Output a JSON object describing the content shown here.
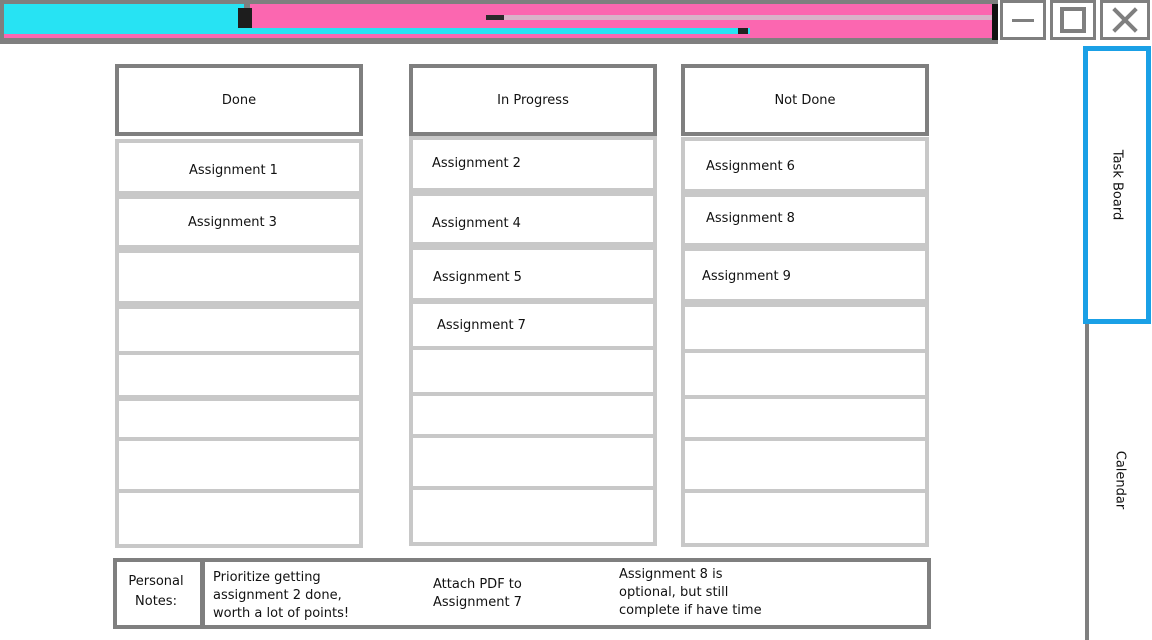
{
  "window": {
    "minimize_label": "",
    "maximize_label": "",
    "close_label": ""
  },
  "columns": {
    "done": {
      "title": "Done",
      "items": [
        "Assignment 1",
        "Assignment 3",
        "",
        "",
        "",
        "",
        "",
        ""
      ]
    },
    "in_progress": {
      "title": "In Progress",
      "items": [
        "Assignment 2",
        "Assignment 4",
        "Assignment 5",
        "Assignment 7",
        "",
        "",
        "",
        ""
      ]
    },
    "not_done": {
      "title": "Not Done",
      "items": [
        "Assignment 6",
        "Assignment 8",
        "Assignment 9",
        "",
        "",
        "",
        "",
        ""
      ]
    }
  },
  "sidebar": {
    "tabs": [
      {
        "label": "Task Board",
        "active": true
      },
      {
        "label": "Calendar",
        "active": false
      }
    ]
  },
  "notes": {
    "label_line1": "Personal",
    "label_line2": "Notes:",
    "note1": [
      "Prioritize getting",
      "assignment 2 done,",
      "worth a lot of points!"
    ],
    "note2": [
      "Attach PDF to",
      "Assignment 7"
    ],
    "note3": [
      "Assignment 8 is",
      "optional, but still",
      "complete if have time"
    ]
  },
  "colors": {
    "titlebar_cyan": "#27e3f3",
    "titlebar_pink": "#fb67b0",
    "frame_gray": "#7f7f7f",
    "cell_border": "#c8c8c8",
    "active_tab": "#1aa0e6"
  }
}
